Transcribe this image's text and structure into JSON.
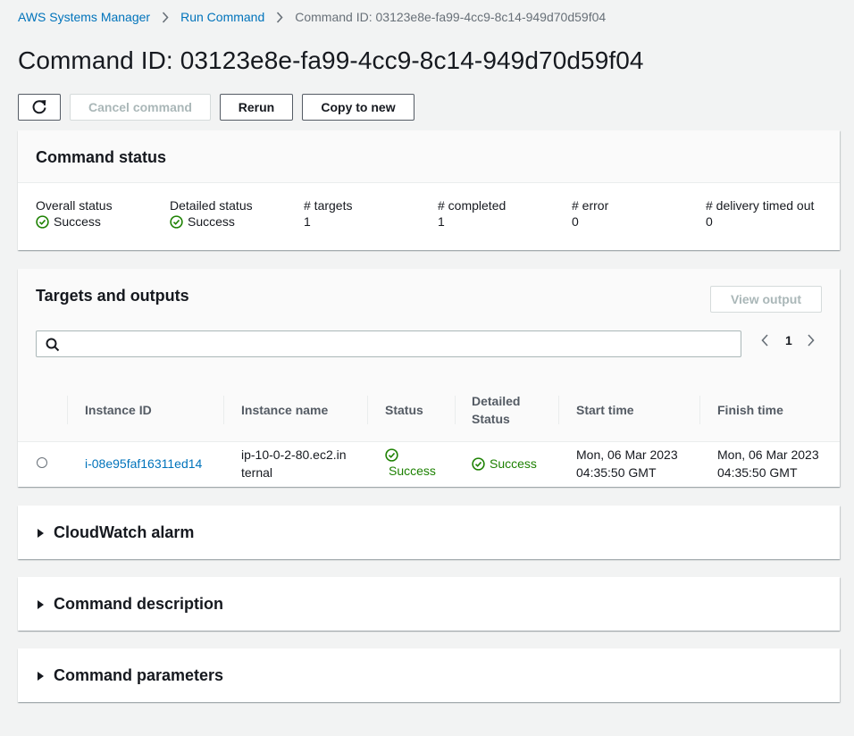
{
  "breadcrumb": {
    "items": [
      "AWS Systems Manager",
      "Run Command"
    ],
    "current": "Command ID: 03123e8e-fa99-4cc9-8c14-949d70d59f04"
  },
  "page": {
    "title": "Command ID: 03123e8e-fa99-4cc9-8c14-949d70d59f04"
  },
  "toolbar": {
    "refresh_icon": "refresh-icon",
    "cancel_label": "Cancel command",
    "rerun_label": "Rerun",
    "copy_label": "Copy to new"
  },
  "command_status": {
    "title": "Command status",
    "overall_status_label": "Overall status",
    "overall_status_value": "Success",
    "detailed_status_label": "Detailed status",
    "detailed_status_value": "Success",
    "targets_label": "# targets",
    "targets_value": "1",
    "completed_label": "# completed",
    "completed_value": "1",
    "error_label": "# error",
    "error_value": "0",
    "timed_out_label": "# delivery timed out",
    "timed_out_value": "0",
    "success_color": "#1d8102"
  },
  "targets": {
    "title": "Targets and outputs",
    "view_output_label": "View output",
    "search_placeholder": "",
    "page_number": "1",
    "columns": [
      "Instance ID",
      "Instance name",
      "Status",
      "Detailed Status",
      "Start time",
      "Finish time"
    ],
    "rows": [
      {
        "instance_id": "i-08e95faf16311ed14",
        "instance_name": "ip-10-0-2-80.ec2.internal",
        "status": "Success",
        "detailed_status": "Success",
        "start_time": "Mon, 06 Mar 2023 04:35:50 GMT",
        "finish_time": "Mon, 06 Mar 2023 04:35:50 GMT"
      }
    ]
  },
  "sections": {
    "cloudwatch": "CloudWatch alarm",
    "description": "Command description",
    "parameters": "Command parameters"
  },
  "colors": {
    "link": "#0073bb",
    "background": "#f2f3f3"
  }
}
